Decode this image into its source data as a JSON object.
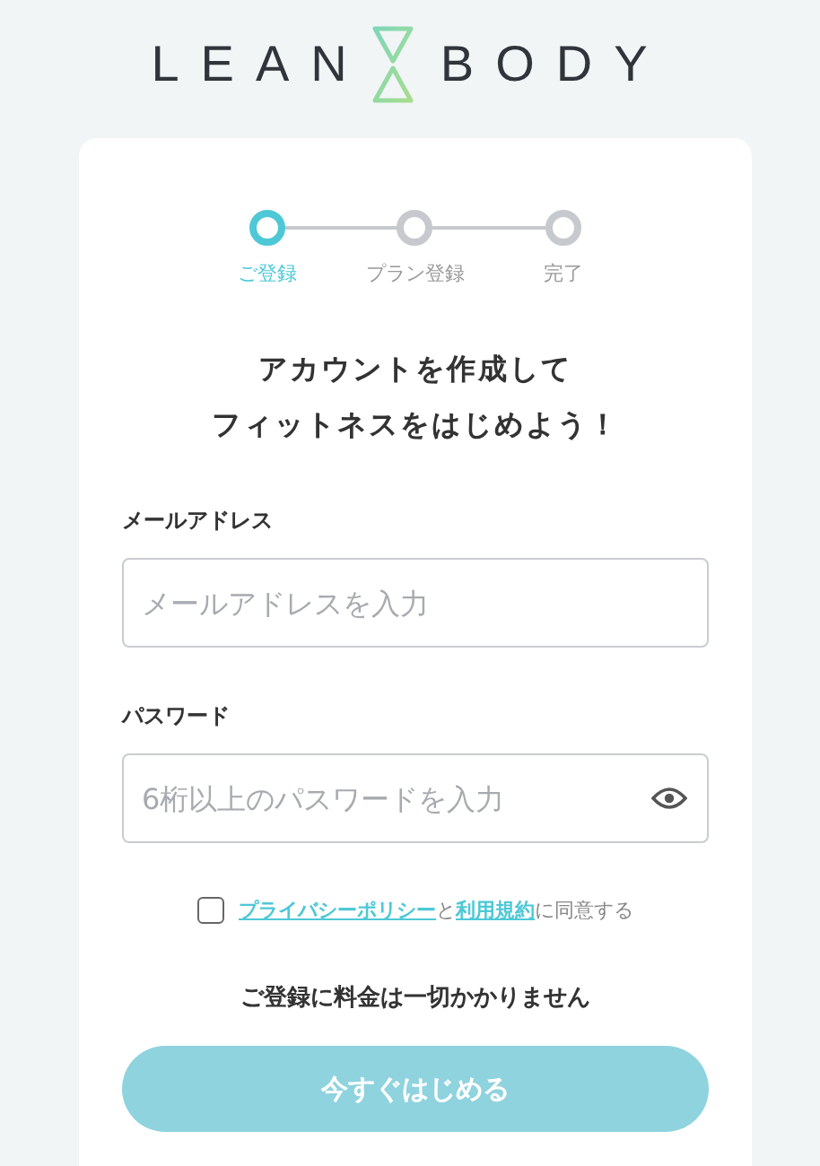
{
  "logo": {
    "left": "LEAN",
    "right": "BODY"
  },
  "steps": [
    {
      "label": "ご登録",
      "selected": true
    },
    {
      "label": "プラン登録",
      "selected": false
    },
    {
      "label": "完了",
      "selected": false
    }
  ],
  "heading": [
    "アカウントを作成して",
    "フィットネスをはじめよう！"
  ],
  "fields": [
    {
      "label": "メールアドレス",
      "placeholder": "メールアドレスを入力",
      "kind": "email"
    },
    {
      "label": "パスワード",
      "placeholder": "6桁以上のパスワードを入力",
      "kind": "password"
    }
  ],
  "consent": {
    "checked": false,
    "parts": [
      {
        "kind": "link",
        "text": "プライバシーポリシー"
      },
      {
        "kind": "text",
        "text": "と"
      },
      {
        "kind": "link",
        "text": "利用規約"
      },
      {
        "kind": "text",
        "text": "に同意する"
      }
    ]
  },
  "note": "ご登録に料金は一切かかりません",
  "submit": {
    "label": "今すぐはじめる",
    "disabled": true
  }
}
